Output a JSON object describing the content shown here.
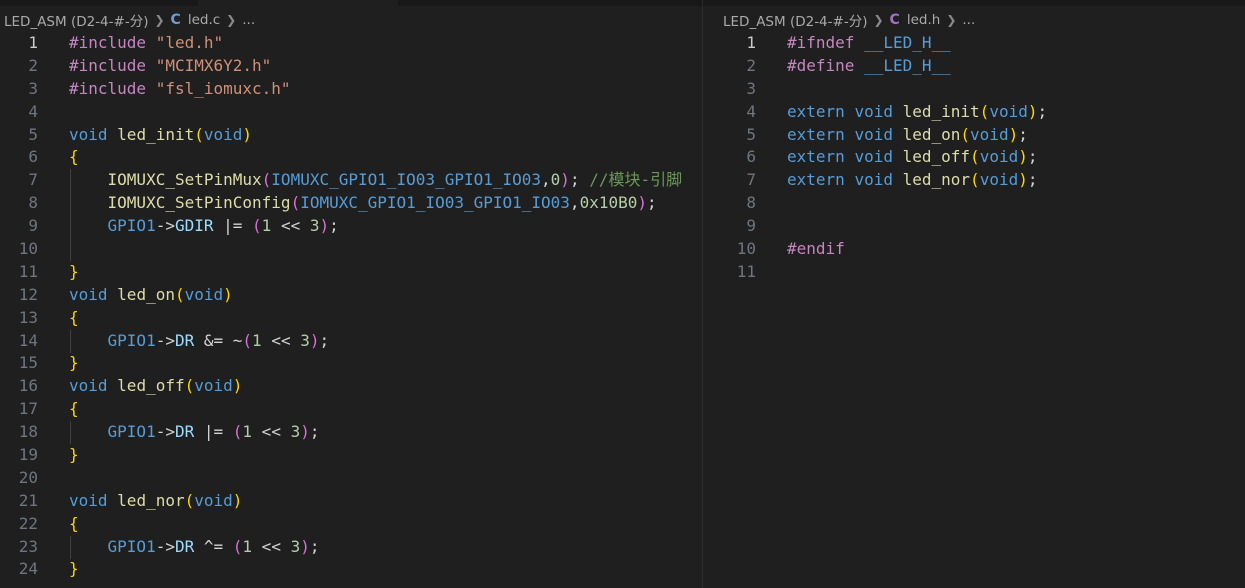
{
  "left_editor": {
    "breadcrumb": {
      "folder": "LED_ASM (D2-4-#-分)",
      "file_icon": "C",
      "file": "led.c",
      "more": "..."
    },
    "current_line": 1,
    "lines": [
      {
        "n": "1",
        "tokens": [
          [
            "dir",
            "#include "
          ],
          [
            "str",
            "\"led.h\""
          ]
        ]
      },
      {
        "n": "2",
        "tokens": [
          [
            "dir",
            "#include "
          ],
          [
            "str",
            "\"MCIMX6Y2.h\""
          ]
        ]
      },
      {
        "n": "3",
        "tokens": [
          [
            "dir",
            "#include "
          ],
          [
            "str",
            "\"fsl_iomuxc.h\""
          ]
        ]
      },
      {
        "n": "4",
        "tokens": []
      },
      {
        "n": "5",
        "tokens": [
          [
            "kw",
            "void"
          ],
          [
            "plain",
            " "
          ],
          [
            "fn",
            "led_init"
          ],
          [
            "b1",
            "("
          ],
          [
            "kw",
            "void"
          ],
          [
            "b1",
            ")"
          ]
        ]
      },
      {
        "n": "6",
        "tokens": [
          [
            "b1",
            "{"
          ]
        ]
      },
      {
        "n": "7",
        "tokens": [
          [
            "plain",
            "    "
          ],
          [
            "fn",
            "IOMUXC_SetPinMux"
          ],
          [
            "b2",
            "("
          ],
          [
            "mac",
            "IOMUXC_GPIO1_IO03_GPIO1_IO03"
          ],
          [
            "plain",
            ","
          ],
          [
            "num",
            "0"
          ],
          [
            "b2",
            ")"
          ],
          [
            "plain",
            "; "
          ],
          [
            "com",
            "//模块-引脚"
          ]
        ]
      },
      {
        "n": "8",
        "tokens": [
          [
            "plain",
            "    "
          ],
          [
            "fn",
            "IOMUXC_SetPinConfig"
          ],
          [
            "b2",
            "("
          ],
          [
            "mac",
            "IOMUXC_GPIO1_IO03_GPIO1_IO03"
          ],
          [
            "plain",
            ","
          ],
          [
            "num",
            "0x10B0"
          ],
          [
            "b2",
            ")"
          ],
          [
            "plain",
            ";"
          ]
        ]
      },
      {
        "n": "9",
        "tokens": [
          [
            "plain",
            "    "
          ],
          [
            "mac",
            "GPIO1"
          ],
          [
            "plain",
            "->"
          ],
          [
            "var",
            "GDIR"
          ],
          [
            "plain",
            " |= "
          ],
          [
            "b2",
            "("
          ],
          [
            "num",
            "1"
          ],
          [
            "plain",
            " << "
          ],
          [
            "num",
            "3"
          ],
          [
            "b2",
            ")"
          ],
          [
            "plain",
            ";"
          ]
        ]
      },
      {
        "n": "10",
        "tokens": []
      },
      {
        "n": "11",
        "tokens": [
          [
            "b1",
            "}"
          ]
        ]
      },
      {
        "n": "12",
        "tokens": [
          [
            "kw",
            "void"
          ],
          [
            "plain",
            " "
          ],
          [
            "fn",
            "led_on"
          ],
          [
            "b1",
            "("
          ],
          [
            "kw",
            "void"
          ],
          [
            "b1",
            ")"
          ]
        ]
      },
      {
        "n": "13",
        "tokens": [
          [
            "b1",
            "{"
          ]
        ]
      },
      {
        "n": "14",
        "tokens": [
          [
            "plain",
            "    "
          ],
          [
            "mac",
            "GPIO1"
          ],
          [
            "plain",
            "->"
          ],
          [
            "var",
            "DR"
          ],
          [
            "plain",
            " &= ~"
          ],
          [
            "b2",
            "("
          ],
          [
            "num",
            "1"
          ],
          [
            "plain",
            " << "
          ],
          [
            "num",
            "3"
          ],
          [
            "b2",
            ")"
          ],
          [
            "plain",
            ";"
          ]
        ]
      },
      {
        "n": "15",
        "tokens": [
          [
            "b1",
            "}"
          ]
        ]
      },
      {
        "n": "16",
        "tokens": [
          [
            "kw",
            "void"
          ],
          [
            "plain",
            " "
          ],
          [
            "fn",
            "led_off"
          ],
          [
            "b1",
            "("
          ],
          [
            "kw",
            "void"
          ],
          [
            "b1",
            ")"
          ]
        ]
      },
      {
        "n": "17",
        "tokens": [
          [
            "b1",
            "{"
          ]
        ]
      },
      {
        "n": "18",
        "tokens": [
          [
            "plain",
            "    "
          ],
          [
            "mac",
            "GPIO1"
          ],
          [
            "plain",
            "->"
          ],
          [
            "var",
            "DR"
          ],
          [
            "plain",
            " |= "
          ],
          [
            "b2",
            "("
          ],
          [
            "num",
            "1"
          ],
          [
            "plain",
            " << "
          ],
          [
            "num",
            "3"
          ],
          [
            "b2",
            ")"
          ],
          [
            "plain",
            ";"
          ]
        ]
      },
      {
        "n": "19",
        "tokens": [
          [
            "b1",
            "}"
          ]
        ]
      },
      {
        "n": "20",
        "tokens": []
      },
      {
        "n": "21",
        "tokens": [
          [
            "kw",
            "void"
          ],
          [
            "plain",
            " "
          ],
          [
            "fn",
            "led_nor"
          ],
          [
            "b1",
            "("
          ],
          [
            "kw",
            "void"
          ],
          [
            "b1",
            ")"
          ]
        ]
      },
      {
        "n": "22",
        "tokens": [
          [
            "b1",
            "{"
          ]
        ]
      },
      {
        "n": "23",
        "tokens": [
          [
            "plain",
            "    "
          ],
          [
            "mac",
            "GPIO1"
          ],
          [
            "plain",
            "->"
          ],
          [
            "var",
            "DR"
          ],
          [
            "plain",
            " ^= "
          ],
          [
            "b2",
            "("
          ],
          [
            "num",
            "1"
          ],
          [
            "plain",
            " << "
          ],
          [
            "num",
            "3"
          ],
          [
            "b2",
            ")"
          ],
          [
            "plain",
            ";"
          ]
        ]
      },
      {
        "n": "24",
        "tokens": [
          [
            "b1",
            "}"
          ]
        ]
      }
    ]
  },
  "right_editor": {
    "breadcrumb": {
      "folder": "LED_ASM (D2-4-#-分)",
      "file_icon": "C",
      "file": "led.h",
      "more": "..."
    },
    "current_line": 1,
    "lines": [
      {
        "n": "1",
        "tokens": [
          [
            "dir",
            "#ifndef "
          ],
          [
            "mac",
            "__LED_H__"
          ]
        ]
      },
      {
        "n": "2",
        "tokens": [
          [
            "dir",
            "#define "
          ],
          [
            "mac",
            "__LED_H__"
          ]
        ]
      },
      {
        "n": "3",
        "tokens": []
      },
      {
        "n": "4",
        "tokens": [
          [
            "kw",
            "extern"
          ],
          [
            "plain",
            " "
          ],
          [
            "kw",
            "void"
          ],
          [
            "plain",
            " "
          ],
          [
            "fn",
            "led_init"
          ],
          [
            "b1",
            "("
          ],
          [
            "kw",
            "void"
          ],
          [
            "b1",
            ")"
          ],
          [
            "plain",
            ";"
          ]
        ]
      },
      {
        "n": "5",
        "tokens": [
          [
            "kw",
            "extern"
          ],
          [
            "plain",
            " "
          ],
          [
            "kw",
            "void"
          ],
          [
            "plain",
            " "
          ],
          [
            "fn",
            "led_on"
          ],
          [
            "b1",
            "("
          ],
          [
            "kw",
            "void"
          ],
          [
            "b1",
            ")"
          ],
          [
            "plain",
            ";"
          ]
        ]
      },
      {
        "n": "6",
        "tokens": [
          [
            "kw",
            "extern"
          ],
          [
            "plain",
            " "
          ],
          [
            "kw",
            "void"
          ],
          [
            "plain",
            " "
          ],
          [
            "fn",
            "led_off"
          ],
          [
            "b1",
            "("
          ],
          [
            "kw",
            "void"
          ],
          [
            "b1",
            ")"
          ],
          [
            "plain",
            ";"
          ]
        ]
      },
      {
        "n": "7",
        "tokens": [
          [
            "kw",
            "extern"
          ],
          [
            "plain",
            " "
          ],
          [
            "kw",
            "void"
          ],
          [
            "plain",
            " "
          ],
          [
            "fn",
            "led_nor"
          ],
          [
            "b1",
            "("
          ],
          [
            "kw",
            "void"
          ],
          [
            "b1",
            ")"
          ],
          [
            "plain",
            ";"
          ]
        ]
      },
      {
        "n": "8",
        "tokens": []
      },
      {
        "n": "9",
        "tokens": []
      },
      {
        "n": "10",
        "tokens": [
          [
            "dir",
            "#endif"
          ]
        ]
      },
      {
        "n": "11",
        "tokens": []
      }
    ]
  },
  "colors": {
    "background": "#1f1f1f",
    "line_number": "#6e7681",
    "line_number_active": "#cccccc",
    "keyword": "#569cd6",
    "function": "#dcdcaa",
    "string": "#ce9178",
    "directive": "#c586c0",
    "number": "#b5cea8",
    "comment": "#6a9955",
    "bracket_level1": "#ffd700",
    "bracket_level2": "#da70d6",
    "c_icon_left": "#6d9fd4",
    "c_icon_right": "#a074c4"
  }
}
